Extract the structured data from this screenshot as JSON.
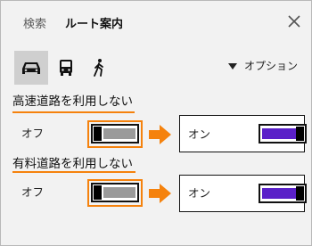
{
  "tabs": {
    "search": "検索",
    "route": "ルート案内"
  },
  "modes": [
    {
      "name": "car-icon",
      "selected": true
    },
    {
      "name": "bus-icon",
      "selected": false
    },
    {
      "name": "walk-icon",
      "selected": false
    }
  ],
  "options_label": "オプション",
  "sections": [
    {
      "title": "高速道路を利用しない",
      "state_off": "オフ",
      "state_on": "オン"
    },
    {
      "title": "有料道路を利用しない",
      "state_off": "オフ",
      "state_on": "オン"
    }
  ],
  "colors": {
    "accent": "#f5820d",
    "toggle_on": "#5a20c8",
    "toggle_off": "#9a9a9a"
  }
}
